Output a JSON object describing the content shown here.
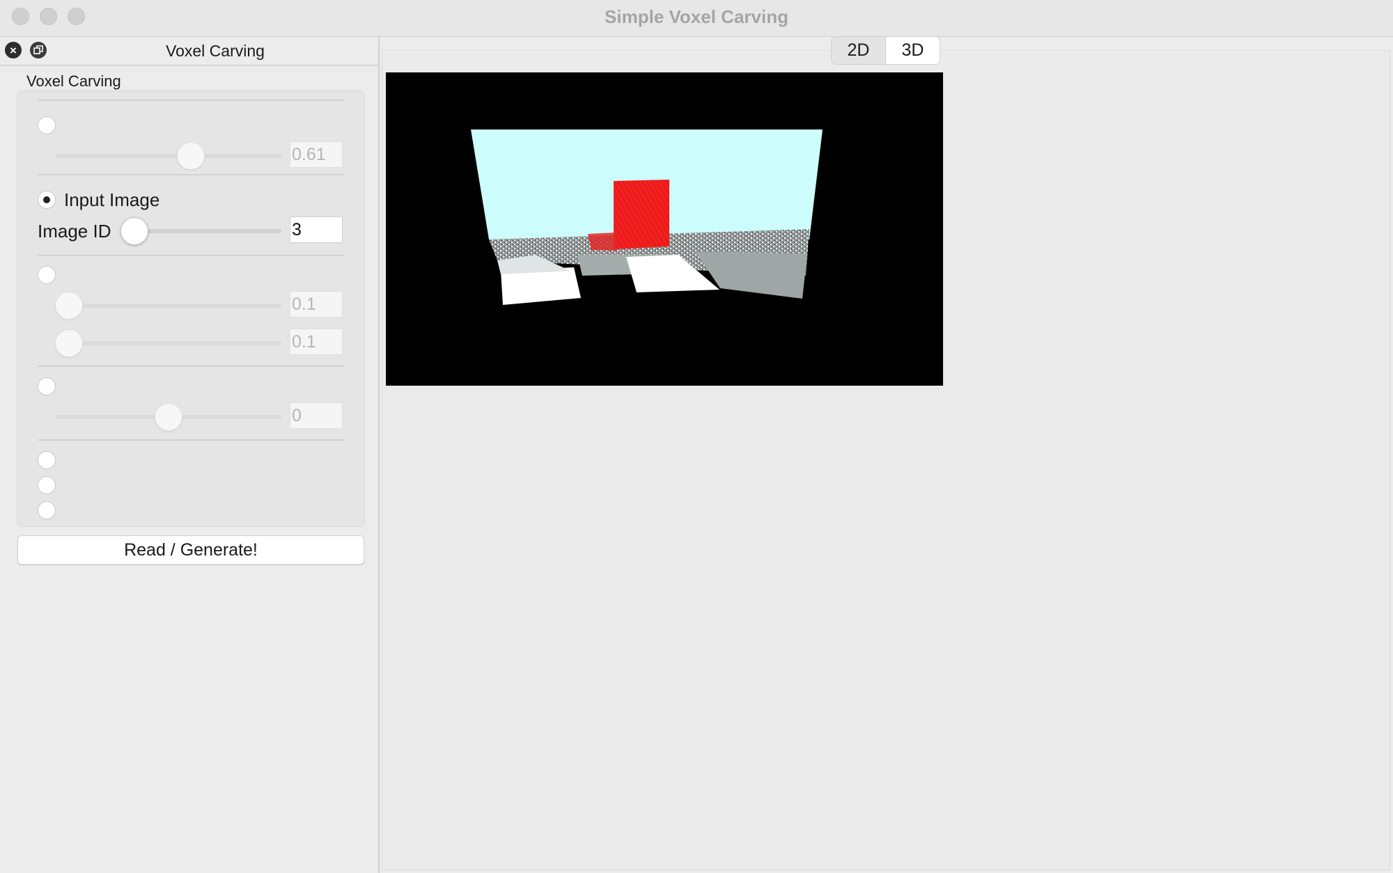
{
  "window": {
    "title": "Simple Voxel Carving"
  },
  "dock": {
    "title": "Voxel Carving"
  },
  "panel": {
    "group_title": "Voxel Carving",
    "section1": {
      "value": "0.61",
      "slider_fraction": 0.61
    },
    "section2": {
      "radio_label": "Input Image",
      "field_label": "Image ID",
      "value": "3"
    },
    "section3": {
      "value_a": "0.1",
      "value_b": "0.1"
    },
    "section4": {
      "value": "0"
    },
    "generate_label": "Read / Generate!"
  },
  "tabs": [
    {
      "label": "2D",
      "selected": false
    },
    {
      "label": "3D",
      "selected": true
    }
  ],
  "colors": {
    "sky": "#ccfcfc",
    "cube": "#f01818",
    "background": "#000000"
  }
}
